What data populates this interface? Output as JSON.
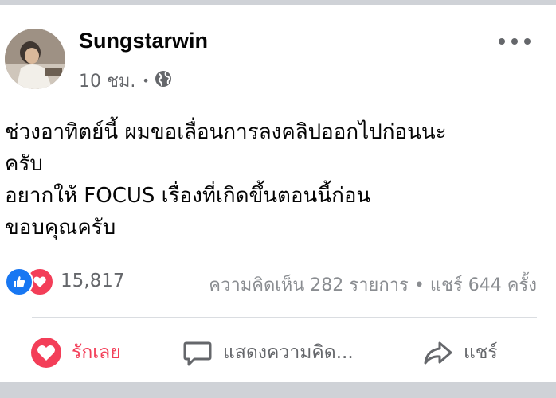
{
  "post": {
    "author": "Sungstarwin",
    "time": "10 ชม.",
    "separator": "•",
    "privacy_icon": "globe-icon",
    "text_lines": [
      "ช่วงอาทิตย์นี้ ผมขอเลื่อนการลงคลิปออกไปก่อนนะ",
      "ครับ",
      "อยากให้ FOCUS เรื่องที่เกิดขึ้นตอนนี้ก่อน",
      "ขอบคุณครับ"
    ]
  },
  "reactions": {
    "icons": [
      "like-icon",
      "love-icon"
    ],
    "count": "15,817"
  },
  "stats": {
    "comments": "ความคิดเห็น 282 รายการ",
    "separator": "•",
    "shares": "แชร์ 644 ครั้ง"
  },
  "actions": {
    "like_label": "รักเลย",
    "comment_label": "แสดงความคิด...",
    "share_label": "แชร์"
  },
  "colors": {
    "love": "#f33e58",
    "like": "#1877f2",
    "secondary_text": "#65676b"
  }
}
